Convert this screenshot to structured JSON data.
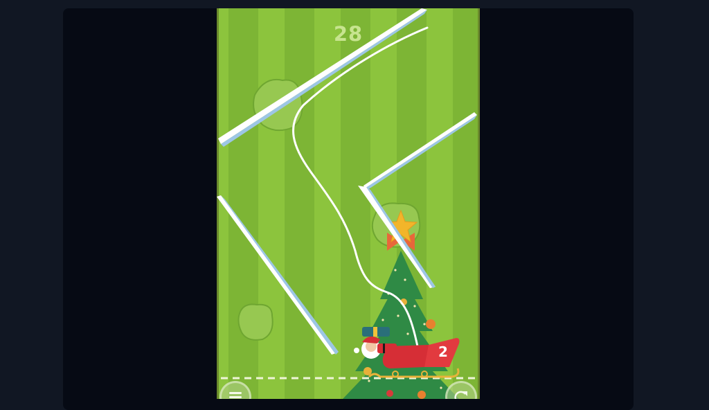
{
  "game": {
    "score": "28",
    "sleigh_number": "2"
  },
  "colors": {
    "stripe_light": "#8cc43d",
    "stripe_dark": "#7db535",
    "bush": "#97c851",
    "ice": "#ffffff",
    "ice_shadow": "#9dc6e5",
    "tree": "#2f8a45",
    "sleigh": "#d62e36",
    "frame_bg": "#060a14",
    "page_bg": "#111723"
  },
  "icons": {
    "menu": "menu-icon",
    "restart": "restart-icon",
    "star": "star-icon"
  }
}
